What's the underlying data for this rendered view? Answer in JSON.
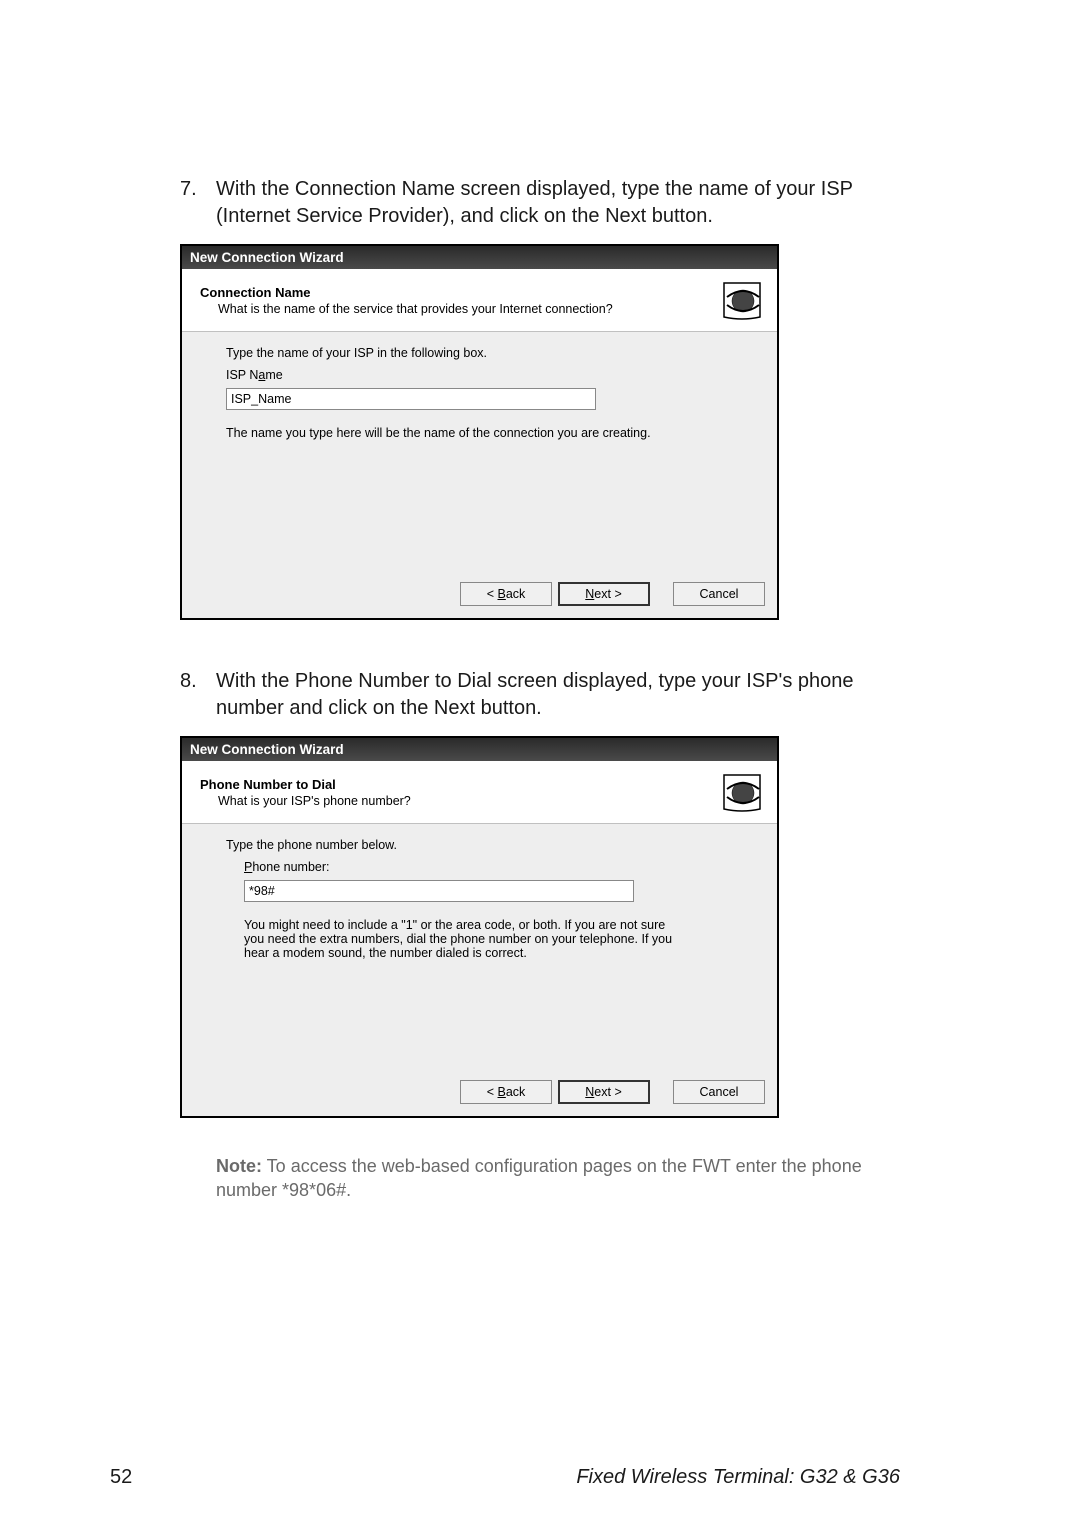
{
  "steps": {
    "seven": {
      "num": "7.",
      "text": "With the Connection Name screen displayed, type the name of your ISP (Internet Service Provider), and click on the Next button."
    },
    "eight": {
      "num": "8.",
      "text": "With the Phone Number to Dial screen displayed, type your ISP's phone number and click on the Next button."
    }
  },
  "dialog1": {
    "titlebar": "New Connection Wizard",
    "header_title": "Connection Name",
    "header_sub": "What is the name of the service that provides your Internet connection?",
    "label_top": "Type the name of your ISP in the following box.",
    "field_prefix": "ISP N",
    "field_hotkey": "a",
    "field_suffix": "me",
    "input_value": "ISP_Name",
    "hint": "The name you type here will be the name of the connection you are creating.",
    "back_prefix": "< ",
    "back_hotkey": "B",
    "back_suffix": "ack",
    "next_hotkey": "N",
    "next_suffix": "ext >",
    "cancel": "Cancel"
  },
  "dialog2": {
    "titlebar": "New Connection Wizard",
    "header_title": "Phone Number to Dial",
    "header_sub": "What is your ISP's phone number?",
    "label_top": "Type the phone number below.",
    "field_hotkey": "P",
    "field_suffix": "hone number:",
    "input_value": "*98#",
    "hint": "You might need to include a \"1\" or the area code, or both. If you are not sure you need the extra numbers, dial the phone number on your telephone. If you hear a modem sound, the number dialed is correct.",
    "back_prefix": "< ",
    "back_hotkey": "B",
    "back_suffix": "ack",
    "next_hotkey": "N",
    "next_suffix": "ext >",
    "cancel": "Cancel"
  },
  "note": {
    "label": "Note:",
    "text": " To access the web-based configuration pages on the FWT enter the phone number *98*06#."
  },
  "footer": {
    "page": "52",
    "title": "Fixed Wireless Terminal: G32 & G36"
  }
}
